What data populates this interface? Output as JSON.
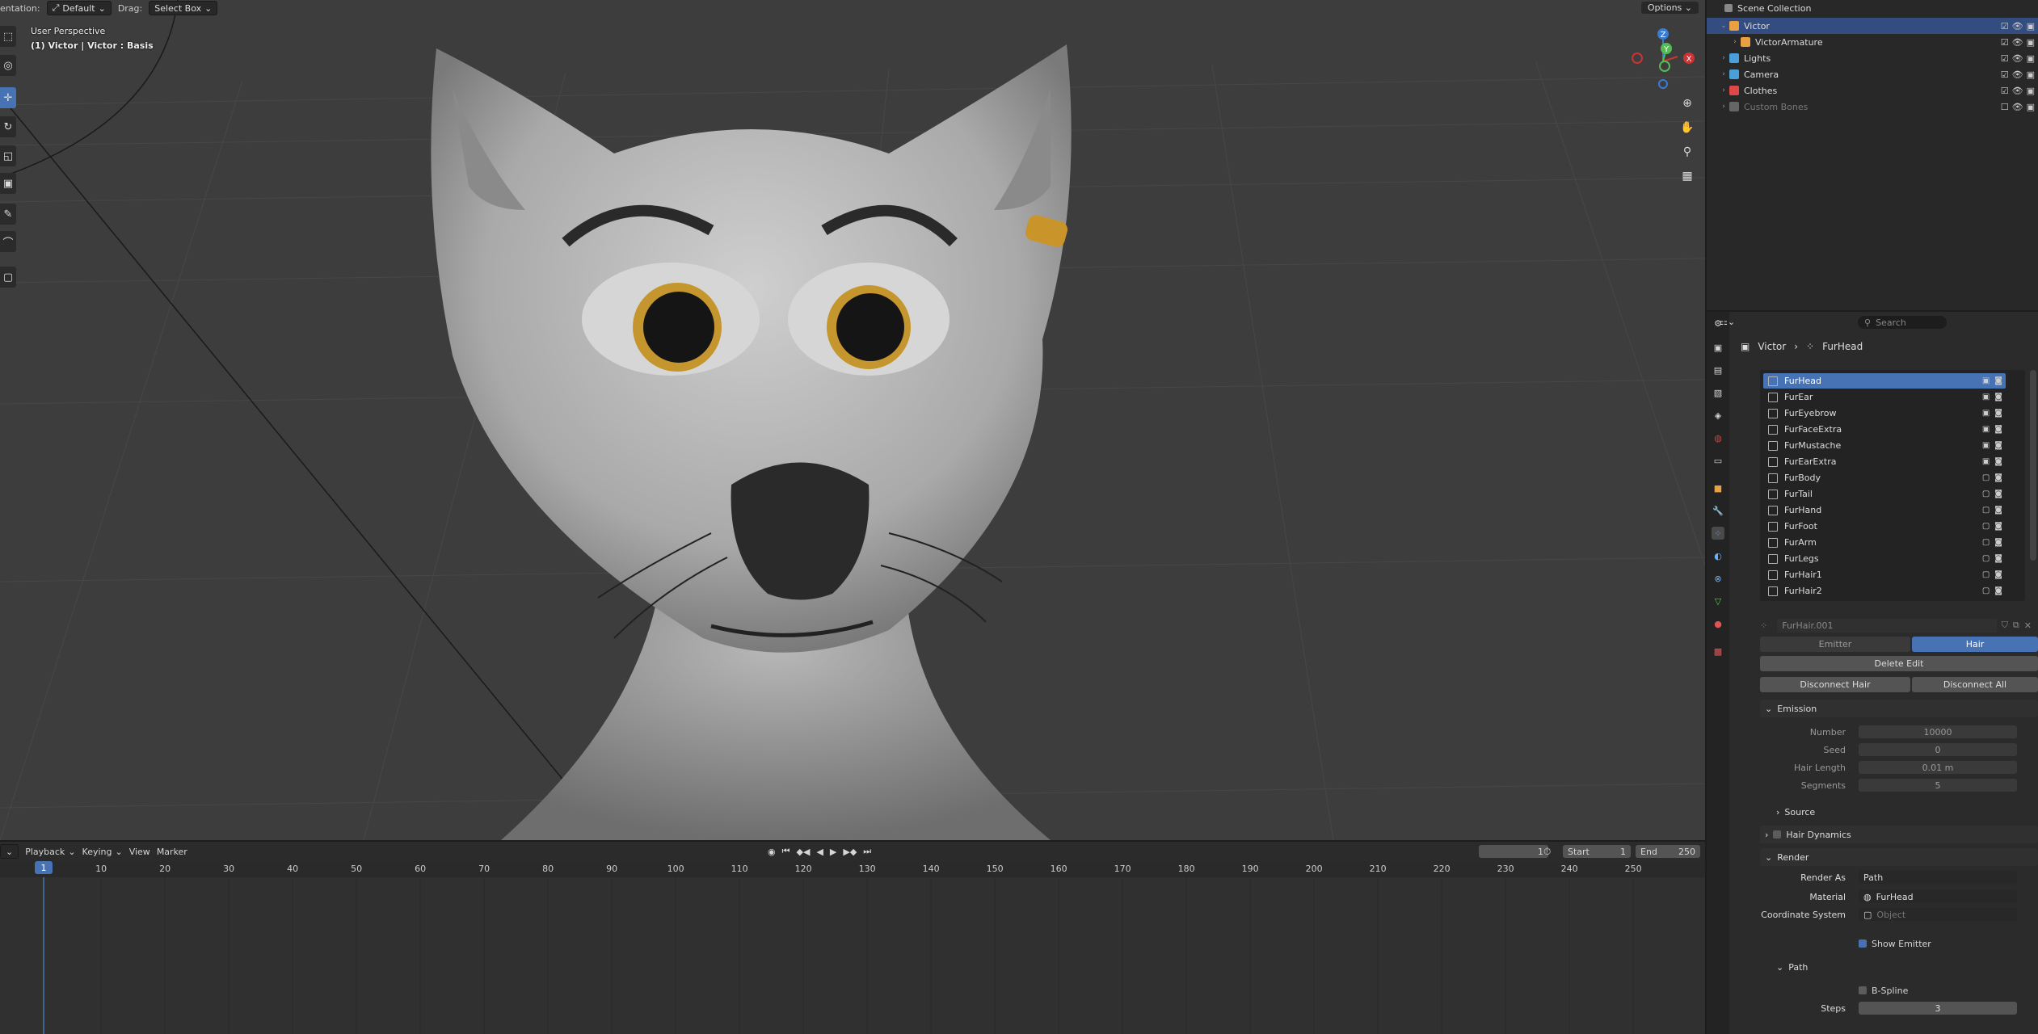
{
  "viewport": {
    "header": {
      "orientation_label": "entation:",
      "orientation_value": "Default",
      "drag_label": "Drag:",
      "drag_value": "Select Box",
      "options_label": "Options"
    },
    "overlay": {
      "perspective": "User Perspective",
      "object_info": "(1) Victor | Victor : Basis"
    },
    "gizmo_axes": [
      "Z",
      "Y",
      "X"
    ]
  },
  "timeline": {
    "menus": [
      "Playback",
      "Keying",
      "View",
      "Marker"
    ],
    "current_frame": "1",
    "start_label": "Start",
    "start_value": "1",
    "end_label": "End",
    "end_value": "250",
    "ruler_ticks": [
      "10",
      "20",
      "30",
      "40",
      "50",
      "60",
      "70",
      "80",
      "90",
      "100",
      "110",
      "120",
      "130",
      "140",
      "150",
      "160",
      "170",
      "180",
      "190",
      "200",
      "210",
      "220",
      "230",
      "240",
      "250"
    ],
    "playhead_frame": "1"
  },
  "outliner": {
    "title": "Scene Collection",
    "rows": [
      {
        "name": "Victor",
        "selected": true,
        "color": "#e8a040"
      },
      {
        "name": "VictorArmature",
        "selected": false,
        "color": "#e8a040"
      },
      {
        "name": "Lights",
        "selected": false,
        "color": "#4a9fd8"
      },
      {
        "name": "Camera",
        "selected": false,
        "color": "#4a9fd8"
      },
      {
        "name": "Clothes",
        "selected": false,
        "color": "#e04848"
      },
      {
        "name": "Custom Bones",
        "selected": false,
        "color": "#666666"
      }
    ]
  },
  "properties": {
    "search_placeholder": "Search",
    "breadcrumb": {
      "object": "Victor",
      "system": "FurHead"
    },
    "particle_systems": [
      "FurHead",
      "FurEar",
      "FurEyebrow",
      "FurFaceExtra",
      "FurMustache",
      "FurEarExtra",
      "FurBody",
      "FurTail",
      "FurHand",
      "FurFoot",
      "FurArm",
      "FurLegs",
      "FurHair1",
      "FurHair2"
    ],
    "settings_name": "FurHair.001",
    "type_tabs": [
      "Emitter",
      "Hair"
    ],
    "delete_edit": "Delete Edit",
    "disconnect_hair": "Disconnect Hair",
    "disconnect_all": "Disconnect All",
    "emission": {
      "title": "Emission",
      "number_label": "Number",
      "number_value": "10000",
      "seed_label": "Seed",
      "seed_value": "0",
      "hair_length_label": "Hair Length",
      "hair_length_value": "0.01 m",
      "segments_label": "Segments",
      "segments_value": "5"
    },
    "source_title": "Source",
    "hair_dynamics_title": "Hair Dynamics",
    "render": {
      "title": "Render",
      "render_as_label": "Render As",
      "render_as_value": "Path",
      "material_label": "Material",
      "material_value": "FurHead",
      "coord_label": "Coordinate System",
      "coord_placeholder": "Object",
      "show_emitter": "Show Emitter"
    },
    "path": {
      "title": "Path",
      "bspline": "B-Spline",
      "steps_label": "Steps",
      "steps_value": "3"
    }
  }
}
